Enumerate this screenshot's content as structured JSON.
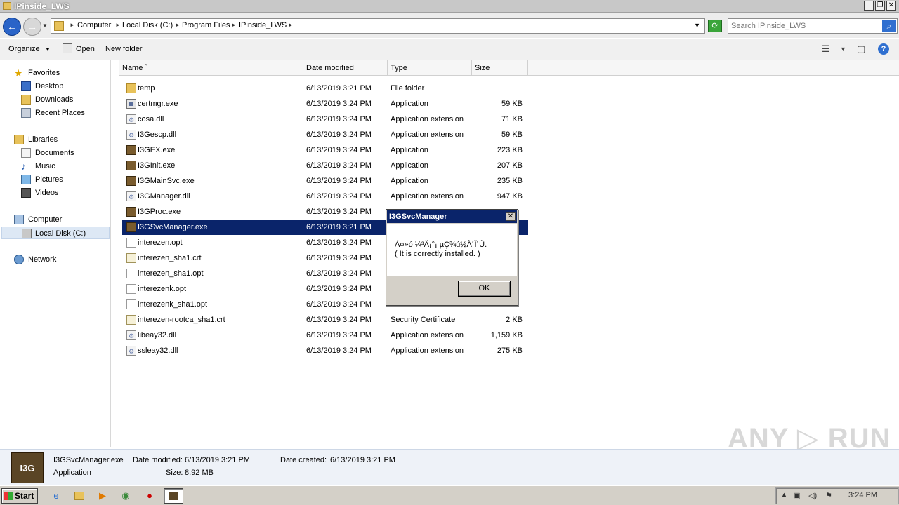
{
  "window": {
    "title": "IPinside_LWS",
    "btn_min": "_",
    "btn_restore": "❐",
    "btn_close": "✕"
  },
  "address": {
    "crumbs": [
      "Computer",
      "Local Disk (C:)",
      "Program Files",
      "IPinside_LWS"
    ],
    "search_placeholder": "Search IPinside_LWS"
  },
  "toolbar": {
    "organize": "Organize",
    "open": "Open",
    "new_folder": "New folder"
  },
  "nav": {
    "favorites": "Favorites",
    "desktop": "Desktop",
    "downloads": "Downloads",
    "recent_places": "Recent Places",
    "libraries": "Libraries",
    "documents": "Documents",
    "music": "Music",
    "pictures": "Pictures",
    "videos": "Videos",
    "computer": "Computer",
    "local_disk": "Local Disk (C:)",
    "network": "Network"
  },
  "columns": {
    "name": "Name",
    "date_modified": "Date modified",
    "type": "Type",
    "size": "Size"
  },
  "files": [
    {
      "name": "temp",
      "date": "6/13/2019 3:21 PM",
      "type": "File folder",
      "size": "",
      "icon": "folder-icon"
    },
    {
      "name": "certmgr.exe",
      "date": "6/13/2019 3:24 PM",
      "type": "Application",
      "size": "59 KB",
      "icon": "application-icon"
    },
    {
      "name": "cosa.dll",
      "date": "6/13/2019 3:24 PM",
      "type": "Application extension",
      "size": "71 KB",
      "icon": "dll-icon"
    },
    {
      "name": "I3Gescp.dll",
      "date": "6/13/2019 3:24 PM",
      "type": "Application extension",
      "size": "59 KB",
      "icon": "dll-icon"
    },
    {
      "name": "I3GEX.exe",
      "date": "6/13/2019 3:24 PM",
      "type": "Application",
      "size": "223 KB",
      "icon": "i3g-app-icon"
    },
    {
      "name": "I3GInit.exe",
      "date": "6/13/2019 3:24 PM",
      "type": "Application",
      "size": "207 KB",
      "icon": "i3g-app-icon"
    },
    {
      "name": "I3GMainSvc.exe",
      "date": "6/13/2019 3:24 PM",
      "type": "Application",
      "size": "235 KB",
      "icon": "i3g-app-icon"
    },
    {
      "name": "I3GManager.dll",
      "date": "6/13/2019 3:24 PM",
      "type": "Application extension",
      "size": "947 KB",
      "icon": "dll-icon"
    },
    {
      "name": "I3GProc.exe",
      "date": "6/13/2019 3:24 PM",
      "type": "",
      "size": "",
      "icon": "i3g-app-icon"
    },
    {
      "name": "I3GSvcManager.exe",
      "date": "6/13/2019 3:21 PM",
      "type": "",
      "size": "",
      "icon": "i3g-app-icon"
    },
    {
      "name": "interezen.opt",
      "date": "6/13/2019 3:24 PM",
      "type": "",
      "size": "",
      "icon": "file-icon"
    },
    {
      "name": "interezen_sha1.crt",
      "date": "6/13/2019 3:24 PM",
      "type": "",
      "size": "",
      "icon": "certificate-icon"
    },
    {
      "name": "interezen_sha1.opt",
      "date": "6/13/2019 3:24 PM",
      "type": "",
      "size": "",
      "icon": "file-icon"
    },
    {
      "name": "interezenk.opt",
      "date": "6/13/2019 3:24 PM",
      "type": "",
      "size": "",
      "icon": "file-icon"
    },
    {
      "name": "interezenk_sha1.opt",
      "date": "6/13/2019 3:24 PM",
      "type": "",
      "size": "",
      "icon": "file-icon"
    },
    {
      "name": "interezen-rootca_sha1.crt",
      "date": "6/13/2019 3:24 PM",
      "type": "Security Certificate",
      "size": "2 KB",
      "icon": "certificate-icon"
    },
    {
      "name": "libeay32.dll",
      "date": "6/13/2019 3:24 PM",
      "type": "Application extension",
      "size": "1,159 KB",
      "icon": "dll-icon"
    },
    {
      "name": "ssleay32.dll",
      "date": "6/13/2019 3:24 PM",
      "type": "Application extension",
      "size": "275 KB",
      "icon": "dll-icon"
    }
  ],
  "selected_row": 9,
  "dialog": {
    "title": "I3GSvcManager",
    "line1": "Á¤»ó ¼³Ä¡°¡ µÇ¾ú½À´Ï´Ù.",
    "line2": "( It is correctly installed. )",
    "ok": "OK",
    "close": "✕"
  },
  "details": {
    "filename": "I3GSvcManager.exe",
    "date_modified_label": "Date modified:",
    "date_modified": "6/13/2019 3:21 PM",
    "date_created_label": "Date created:",
    "date_created": "6/13/2019 3:21 PM",
    "type": "Application",
    "size_label": "Size:",
    "size": "8.92 MB",
    "icon_text": "I3G"
  },
  "watermark": "ANY ▷ RUN",
  "taskbar": {
    "start": "Start",
    "clock": "3:24 PM"
  },
  "colors": {
    "selection": "#0a246a",
    "dialog_title": "#0a246a",
    "folder": "#e8c25a"
  }
}
